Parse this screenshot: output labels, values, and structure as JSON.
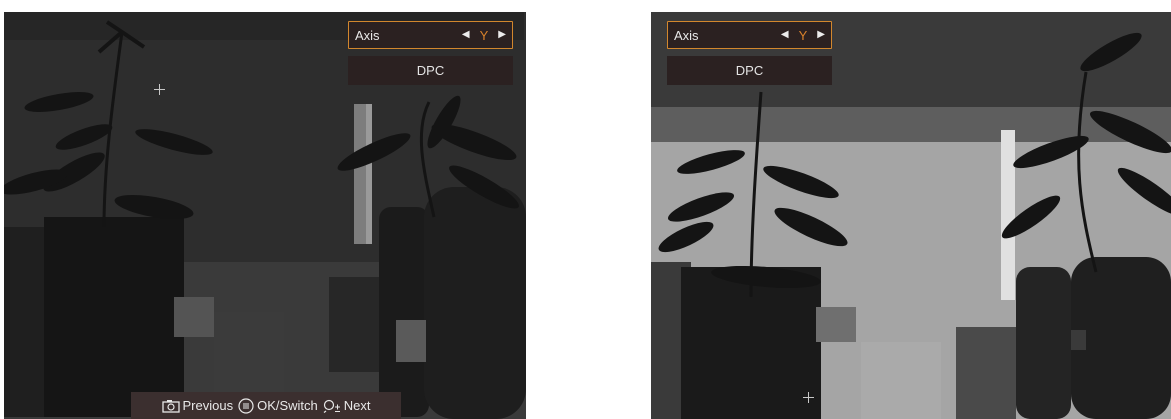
{
  "left_view": {
    "menu": {
      "axis_label": "Axis",
      "axis_prev_icon": "triangle-left-icon",
      "axis_value": "Y",
      "axis_next_icon": "triangle-right-icon",
      "dpc_label": "DPC"
    },
    "hints": {
      "previous_icon": "camera-icon",
      "previous_label": "Previous",
      "ok_icon": "menu-button-icon",
      "ok_label": "OK/Switch",
      "next_icon": "zoom-plus-minus-icon",
      "next_label": "Next"
    },
    "reticle_icon": "crosshair-icon"
  },
  "right_view": {
    "menu": {
      "axis_label": "Axis",
      "axis_prev_icon": "triangle-left-icon",
      "axis_value": "Y",
      "axis_next_icon": "triangle-right-icon",
      "dpc_label": "DPC"
    },
    "reticle_icon": "crosshair-icon"
  },
  "colors": {
    "menu_background": "#2b2121",
    "menu_highlight_border": "#d2872d",
    "axis_value": "#d9822b",
    "menu_text": "#e9e9e9"
  }
}
